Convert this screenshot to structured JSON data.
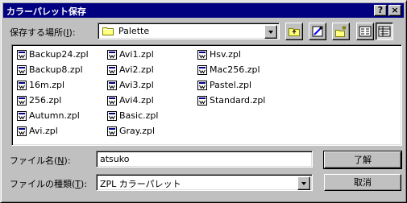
{
  "window": {
    "title": "カラーパレット保存",
    "help_label": "?",
    "close_label": "×"
  },
  "location": {
    "label_prefix": "保存する場所(",
    "label_key": "I",
    "label_suffix": "):",
    "value": "Palette"
  },
  "toolbar": {
    "up_icon": "up-folder-icon",
    "desktop_icon": "desktop-icon",
    "newfolder_icon": "new-folder-icon",
    "list_icon": "list-view-icon",
    "details_icon": "details-view-icon"
  },
  "files": [
    [
      "Backup24.zpl",
      "Backup8.zpl",
      "16m.zpl",
      "256.zpl",
      "Autumn.zpl",
      "Avi.zpl"
    ],
    [
      "Avi1.zpl",
      "Avi2.zpl",
      "Avi3.zpl",
      "Avi4.zpl",
      "Basic.zpl",
      "Gray.zpl"
    ],
    [
      "Hsv.zpl",
      "Mac256.zpl",
      "Pastel.zpl",
      "Standard.zpl"
    ]
  ],
  "filename": {
    "label_prefix": "ファイル名(",
    "label_key": "N",
    "label_suffix": "):",
    "value": "atsuko"
  },
  "filetype": {
    "label_prefix": "ファイルの種類(",
    "label_key": "T",
    "label_suffix": "):",
    "value": "ZPL カラーパレット"
  },
  "buttons": {
    "ok": "了解",
    "cancel": "取消"
  }
}
